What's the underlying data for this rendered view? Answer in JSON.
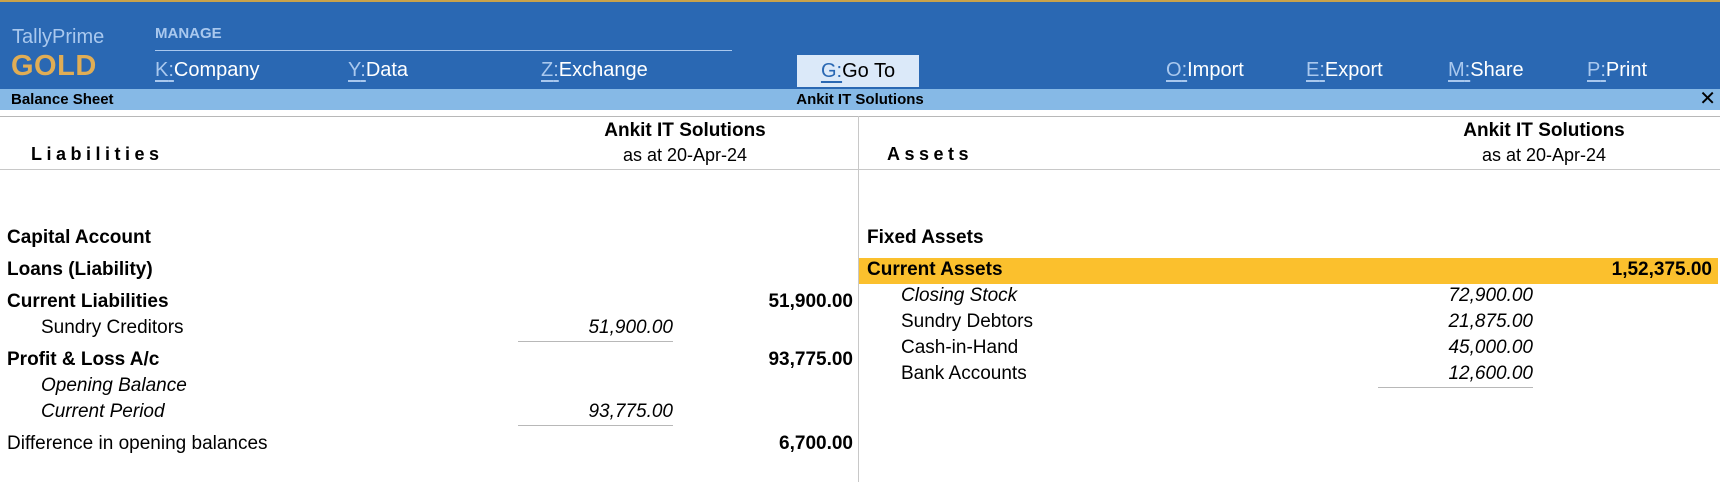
{
  "brand": {
    "name": "TallyPrime",
    "edition": "GOLD"
  },
  "menu": {
    "manage_label": "MANAGE",
    "company": {
      "key": "K",
      "label": "Company"
    },
    "data": {
      "key": "Y",
      "label": "Data"
    },
    "exchange": {
      "key": "Z",
      "label": "Exchange"
    },
    "goto": {
      "key": "G",
      "label": "Go To"
    },
    "import": {
      "key": "O",
      "label": "Import"
    },
    "export": {
      "key": "E",
      "label": "Export"
    },
    "share": {
      "key": "M",
      "label": "Share"
    },
    "print": {
      "key": "P",
      "label": "Print"
    }
  },
  "titlebar": {
    "report": "Balance Sheet",
    "company": "Ankit IT Solutions",
    "close_icon": "close-icon"
  },
  "liabilities": {
    "title": "Liabilities",
    "company": "Ankit IT Solutions",
    "as_at": "as at 20-Apr-24",
    "capital_account": "Capital Account",
    "loans": "Loans (Liability)",
    "current_liabilities": {
      "label": "Current Liabilities",
      "amount": "51,900.00"
    },
    "sundry_creditors": {
      "label": "Sundry Creditors",
      "amount": "51,900.00"
    },
    "profit_loss": {
      "label": "Profit & Loss A/c",
      "amount": "93,775.00"
    },
    "opening_balance": {
      "label": "Opening Balance"
    },
    "current_period": {
      "label": "Current Period",
      "amount": "93,775.00"
    },
    "difference": {
      "label": "Difference in opening balances",
      "amount": "6,700.00"
    }
  },
  "assets": {
    "title": "Assets",
    "company": "Ankit IT Solutions",
    "as_at": "as at 20-Apr-24",
    "fixed_assets": "Fixed Assets",
    "current_assets": {
      "label": "Current Assets",
      "amount": "1,52,375.00"
    },
    "closing_stock": {
      "label": "Closing Stock",
      "amount": "72,900.00"
    },
    "sundry_debtors": {
      "label": "Sundry Debtors",
      "amount": "21,875.00"
    },
    "cash_in_hand": {
      "label": "Cash-in-Hand",
      "amount": "45,000.00"
    },
    "bank_accounts": {
      "label": "Bank Accounts",
      "amount": "12,600.00"
    }
  },
  "colors": {
    "topbar": "#2a68b3",
    "titlebar": "#86b9e6",
    "highlight": "#fbc02d",
    "brand_edition": "#e0ad55"
  }
}
